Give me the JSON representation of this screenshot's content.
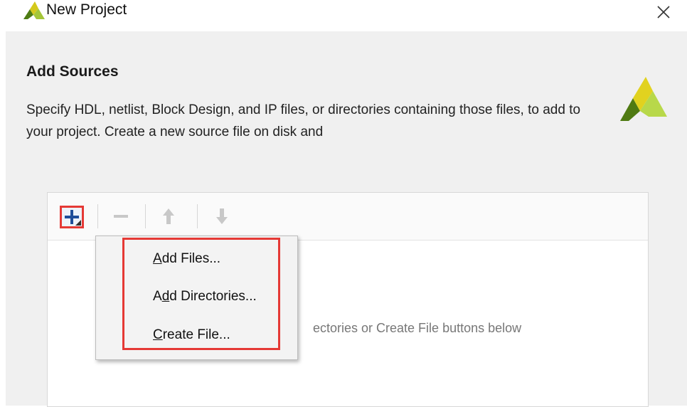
{
  "window": {
    "title": "New Project",
    "logo_icon": "xilinx-vivado-logo",
    "close_icon": "close-icon"
  },
  "page": {
    "heading": "Add Sources",
    "description": "Specify HDL, netlist, Block Design, and IP files, or directories containing those files, to add to your project. Create a new source file on disk and"
  },
  "toolbar": {
    "buttons": [
      {
        "name": "add",
        "icon": "plus-icon",
        "enabled": true,
        "highlighted": true
      },
      {
        "name": "remove",
        "icon": "minus-icon",
        "enabled": false
      },
      {
        "name": "move-up",
        "icon": "arrow-up-icon",
        "enabled": false
      },
      {
        "name": "move-down",
        "icon": "arrow-down-icon",
        "enabled": false
      }
    ]
  },
  "sources_list": {
    "hint_visible_fragment": "ectories or Create File buttons below"
  },
  "add_menu": {
    "items": [
      {
        "first": "A",
        "rest": "dd Files..."
      },
      {
        "first": "A",
        "underline": "d",
        "rest": "d Directories..."
      },
      {
        "first": "C",
        "rest": "reate File..."
      }
    ]
  },
  "colors": {
    "highlight": "#e53935",
    "background": "#f0f0f0",
    "accent_blue": "#1f4e9a",
    "logo_green": "#7cb342"
  }
}
